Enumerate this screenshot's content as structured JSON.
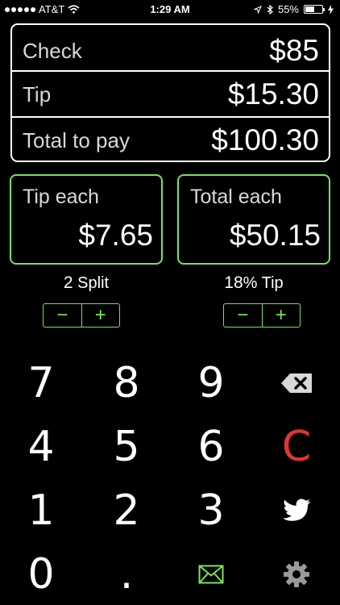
{
  "status": {
    "carrier": "AT&T",
    "time": "1:29 AM",
    "battery": "55%",
    "battery_level": 0.55
  },
  "summary": {
    "check_label": "Check",
    "check_value": "$85",
    "tip_label": "Tip",
    "tip_value": "$15.30",
    "total_label": "Total to pay",
    "total_value": "$100.30"
  },
  "tip_each": {
    "label": "Tip each",
    "value": "$7.65"
  },
  "total_each": {
    "label": "Total each",
    "value": "$50.15"
  },
  "split": {
    "value": "2",
    "label": " Split",
    "minus": "−",
    "plus": "+"
  },
  "tip_pct": {
    "value": "18",
    "label": "% Tip",
    "minus": "−",
    "plus": "+"
  },
  "keypad": {
    "k7": "7",
    "k8": "8",
    "k9": "9",
    "k4": "4",
    "k5": "5",
    "k6": "6",
    "k1": "1",
    "k2": "2",
    "k3": "3",
    "k0": "0",
    "dot": ".",
    "clear": "C"
  },
  "icons": {
    "backspace": "backspace-icon",
    "twitter": "twitter-icon",
    "mail": "mail-icon",
    "settings": "gear-icon"
  },
  "colors": {
    "accent": "#7be25a",
    "clear": "#e3352e",
    "background": "#000000"
  }
}
